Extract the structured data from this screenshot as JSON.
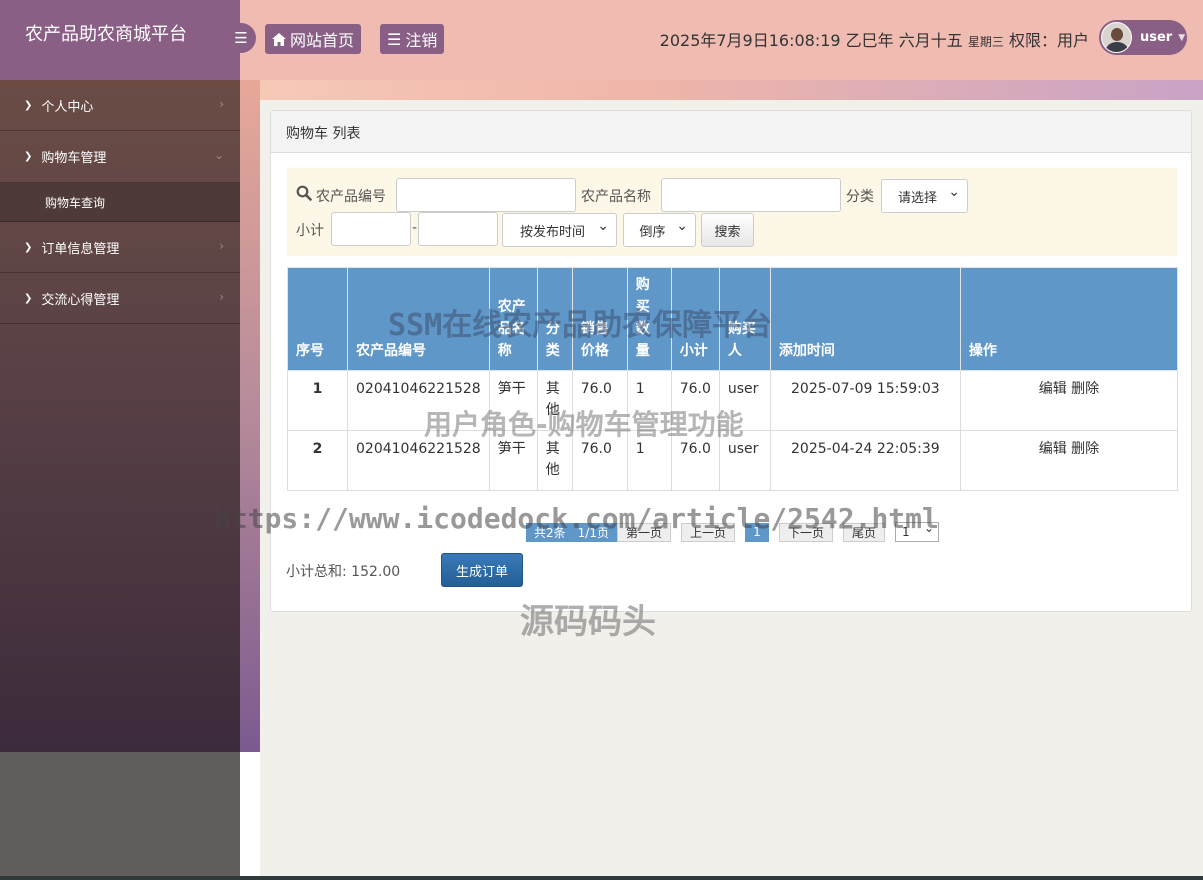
{
  "app": {
    "title": "农产品助农商城平台"
  },
  "header": {
    "home_label": "网站首页",
    "logout_label": "注销",
    "datetime": "2025年7月9日16:08:19 乙巳年 六月十五",
    "weekday": "星期三",
    "role": "权限：用户",
    "username": "user"
  },
  "sidebar": {
    "items": [
      {
        "label": "个人中心"
      },
      {
        "label": "购物车管理",
        "sub": "购物车查询"
      },
      {
        "label": "订单信息管理"
      },
      {
        "label": "交流心得管理"
      }
    ]
  },
  "panel": {
    "title": "购物车 列表"
  },
  "search": {
    "code_label": "农产品编号",
    "name_label": "农产品名称",
    "category_label": "分类",
    "category_value": "请选择",
    "subtotal_label": "小计",
    "sort_field": "按发布时间",
    "sort_order": "倒序",
    "button": "搜索",
    "dash": "-"
  },
  "table": {
    "headers": [
      "序号",
      "农产品编号",
      "农产品名称",
      "分类",
      "销售价格",
      "购买数量",
      "小计",
      "购买人",
      "添加时间",
      "操作"
    ],
    "rows": [
      {
        "no": "1",
        "code": "02041046221528",
        "name": "笋干",
        "category": "其他",
        "price": "76.0",
        "qty": "1",
        "subtotal": "76.0",
        "buyer": "user",
        "time": "2025-07-09 15:59:03"
      },
      {
        "no": "2",
        "code": "02041046221528",
        "name": "笋干",
        "category": "其他",
        "price": "76.0",
        "qty": "1",
        "subtotal": "76.0",
        "buyer": "user",
        "time": "2025-04-24 22:05:39"
      }
    ],
    "edit_label": "编辑",
    "delete_label": "删除"
  },
  "pager": {
    "info": "共2条　1/1页",
    "first": "第一页",
    "prev": "上一页",
    "current": "1",
    "next": "下一页",
    "last": "尾页",
    "select_value": "1"
  },
  "summary": {
    "total": "小计总和: 152.00",
    "order_button": "生成订单"
  },
  "watermarks": {
    "line1": "SSM在线农产品助农保障平台",
    "line2": "用户角色-购物车管理功能",
    "line3": "https://www.icodedock.com/article/2542.html",
    "line4": "源码码头"
  },
  "colors": {
    "brand": "#8a5f86",
    "header": "#f0bcb2",
    "table_head": "#6097c9",
    "order_button": "#2a6aa6"
  },
  "icons": {
    "menu": "bars-icon",
    "home": "home-icon",
    "logout": "list-icon",
    "search": "search-icon",
    "chevron": "chevron-right-icon"
  }
}
